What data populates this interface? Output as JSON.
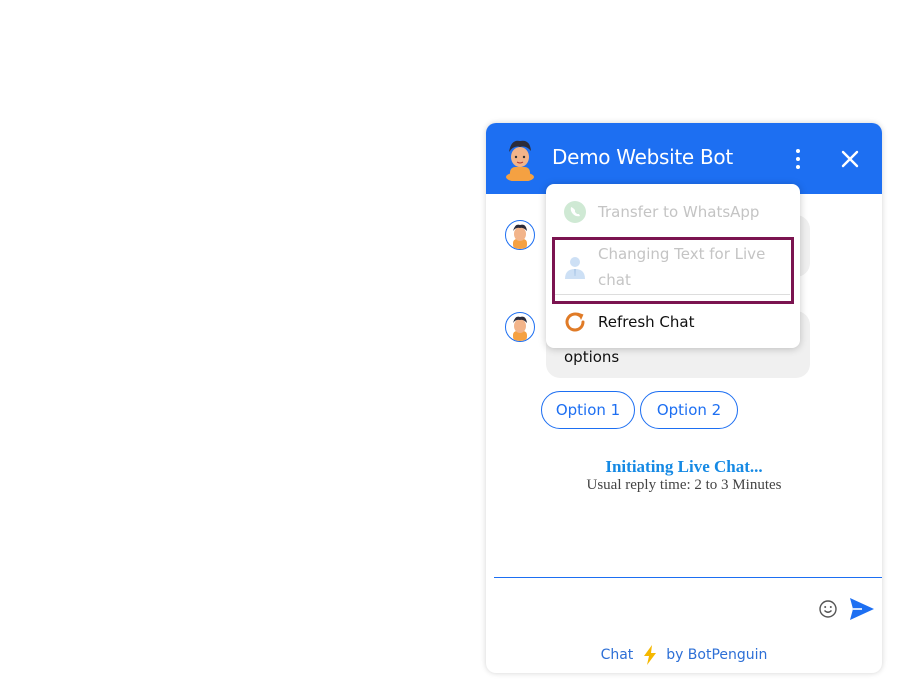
{
  "header": {
    "title": "Demo Website Bot"
  },
  "menu": {
    "items": [
      {
        "label": "Transfer to WhatsApp",
        "icon": "whatsapp-icon",
        "state": "disabled"
      },
      {
        "label_line1": "Changing Text for Live",
        "label_line2": "chat",
        "icon": "agent-icon",
        "state": "disabled"
      },
      {
        "label": "Refresh Chat",
        "icon": "refresh-icon",
        "state": "enabled"
      }
    ]
  },
  "messages": {
    "second_bubble_text": "options"
  },
  "options": [
    "Option 1",
    "Option 2"
  ],
  "live_chat": {
    "title": "Initiating Live Chat...",
    "subtitle": "Usual reply time: 2 to 3 Minutes"
  },
  "composer": {
    "placeholder": ""
  },
  "footer": {
    "chat": "Chat",
    "by": "by BotPenguin"
  },
  "colors": {
    "brand": "#1d6ff2",
    "highlight": "#7b1450",
    "live_title": "#1589e4"
  }
}
